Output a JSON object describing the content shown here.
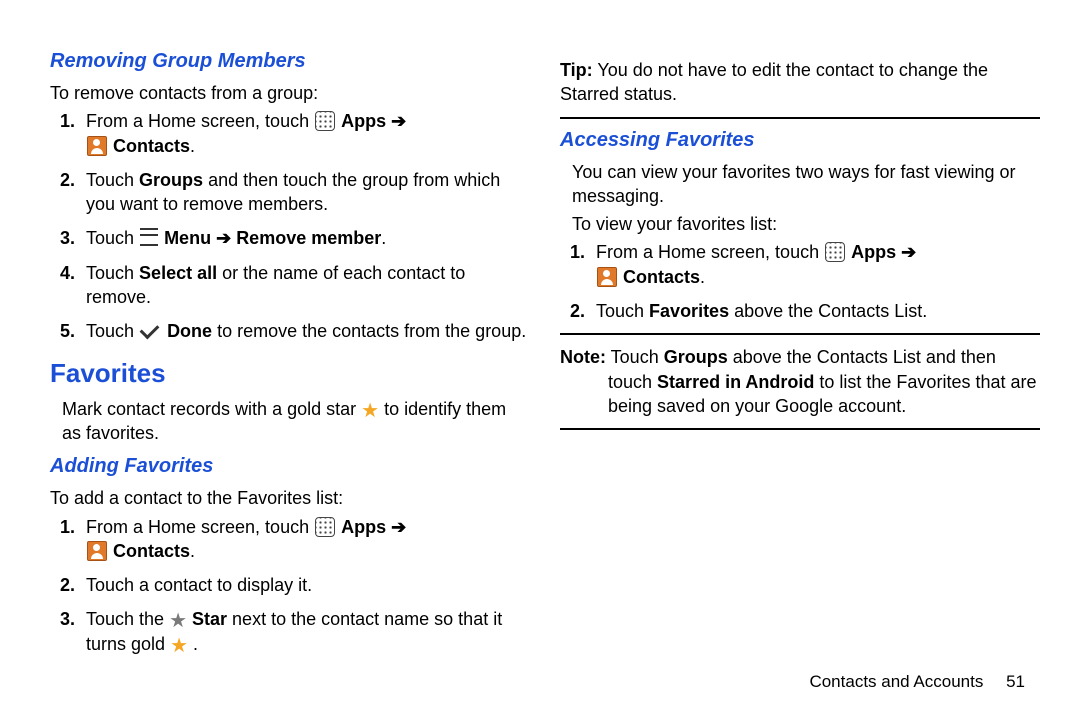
{
  "left": {
    "h_remove": "Removing Group Members",
    "remove_intro": "To remove contacts from a group:",
    "remove_steps": {
      "s1a": "From a Home screen, touch ",
      "apps": "Apps",
      "arrow": "➔",
      "contacts": "Contacts",
      "period": ".",
      "s2a": "Touch ",
      "s2b": "Groups",
      "s2c": " and then touch the group from which you want to remove members.",
      "s3a": "Touch ",
      "s3b": "Menu",
      "s3c": "Remove member",
      "s4a": "Touch ",
      "s4b": "Select all",
      "s4c": " or the name of each contact to remove.",
      "s5a": "Touch ",
      "s5b": "Done",
      "s5c": " to remove the contacts from the group."
    },
    "h_fav": "Favorites",
    "fav_intro_a": "Mark contact records with a gold star ",
    "fav_intro_b": " to identify them as favorites.",
    "h_add": "Adding Favorites",
    "add_intro": "To add a contact to the Favorites list:",
    "add_steps": {
      "s1a": "From a Home screen, touch ",
      "s2": "Touch a contact to display it.",
      "s3a": "Touch the ",
      "s3b": "Star",
      "s3c": " next to the contact name so that it turns gold ",
      "s3d": "."
    }
  },
  "right": {
    "tip_label": "Tip:",
    "tip_text": " You do not have to edit the contact to change the Starred status.",
    "h_access": "Accessing Favorites",
    "access_p1": "You can view your favorites two ways for fast viewing or messaging.",
    "access_p2": "To view your favorites list:",
    "steps": {
      "s1a": "From a Home screen, touch ",
      "s2a": "Touch ",
      "s2b": "Favorites",
      "s2c": " above the Contacts List."
    },
    "note_label": "Note:",
    "note_a": " Touch ",
    "note_b": "Groups",
    "note_c": " above the Contacts List and then touch ",
    "note_d": "Starred in Android",
    "note_e": " to list the Favorites that are being saved on your Google account."
  },
  "common": {
    "apps": "Apps",
    "arrow": "➔",
    "contacts": "Contacts",
    "period": "."
  },
  "footer": {
    "chapter": "Contacts and Accounts",
    "page": "51"
  }
}
